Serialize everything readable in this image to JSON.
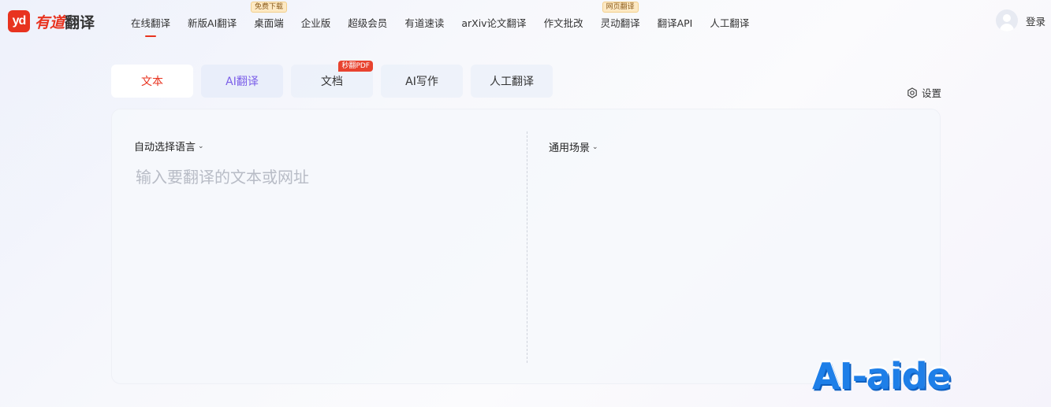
{
  "logo": {
    "badge": "yd",
    "brand_red": "有道",
    "brand": "翻译"
  },
  "nav": {
    "items": [
      {
        "label": "在线翻译",
        "active": true
      },
      {
        "label": "新版AI翻译"
      },
      {
        "label": "桌面端",
        "badge": "免费下载"
      },
      {
        "label": "企业版"
      },
      {
        "label": "超级会员"
      },
      {
        "label": "有道速读"
      },
      {
        "label": "arXiv论文翻译"
      },
      {
        "label": "作文批改"
      },
      {
        "label": "灵动翻译",
        "badge": "网页翻译"
      },
      {
        "label": "翻译API"
      },
      {
        "label": "人工翻译"
      }
    ],
    "login": "登录"
  },
  "tabs": [
    {
      "label": "文本",
      "active": true
    },
    {
      "label": "AI翻译"
    },
    {
      "label": "文档",
      "badge": "秒翻PDF"
    },
    {
      "label": "AI写作"
    },
    {
      "label": "人工翻译"
    }
  ],
  "settings_label": "设置",
  "translator": {
    "source_lang": "自动选择语言",
    "scene": "通用场景",
    "placeholder": "输入要翻译的文本或网址"
  },
  "watermark": "AI-aide",
  "colors": {
    "accent": "#e8331f",
    "ai_purple": "#7b5ee8",
    "watermark_blue": "#1e7fe8"
  }
}
